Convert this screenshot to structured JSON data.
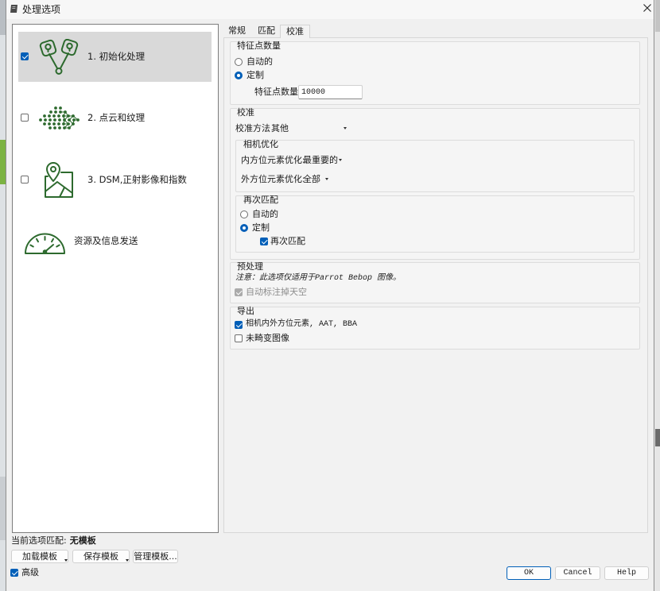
{
  "window": {
    "title": "处理选项",
    "app_icon": "app-icon",
    "close_icon": "close-icon"
  },
  "steps": [
    {
      "label": "1. 初始化处理",
      "checked": true,
      "selected": true,
      "icon": "initial-processing-icon"
    },
    {
      "label": "2. 点云和纹理",
      "checked": false,
      "selected": false,
      "icon": "point-cloud-icon"
    },
    {
      "label": "3. DSM,正射影像和指数",
      "checked": false,
      "selected": false,
      "icon": "dsm-map-pin-icon"
    },
    {
      "label": "资源及信息发送",
      "selected": false,
      "icon": "gauge-icon"
    }
  ],
  "tabs": [
    {
      "label": "常规",
      "active": false
    },
    {
      "label": "匹配",
      "active": false
    },
    {
      "label": "校准",
      "active": true
    }
  ],
  "keypoints": {
    "title": "特征点数量",
    "auto_label": "自动的",
    "auto_selected": false,
    "custom_label": "定制",
    "custom_selected": true,
    "count_label": "特征点数量:",
    "count_value": "10000"
  },
  "calibration": {
    "title": "校准",
    "method_label": "校准方法",
    "method_value": "其他",
    "camera_optimization": {
      "title": "相机优化",
      "internal_label": "内方位元素优化:",
      "internal_value": "最重要的",
      "external_label": "外方位元素优化:",
      "external_value": "全部"
    },
    "rematch": {
      "title": "再次匹配",
      "auto_label": "自动的",
      "auto_selected": false,
      "custom_label": "定制",
      "custom_selected": true,
      "rematch_label": "再次匹配",
      "rematch_checked": true
    }
  },
  "preprocessing": {
    "title": "预处理",
    "note": "注意：此选项仅适用于Parrot Bebop 图像。",
    "sky_label": "自动标注掉天空",
    "sky_checked": true,
    "sky_enabled": false
  },
  "export": {
    "title": "导出",
    "camera_params_label": "相机内外方位元素, AAT, BBA",
    "camera_params_checked": true,
    "undistorted_label": "未畸变图像",
    "undistorted_checked": false
  },
  "templates": {
    "current_label": "当前选项匹配:",
    "current_value": "无模板",
    "load_label": "加载模板",
    "save_label": "保存模板",
    "manage_label": "管理模板..."
  },
  "advanced": {
    "label": "高级",
    "checked": true
  },
  "buttons": {
    "ok_label": "OK",
    "cancel_label": "Cancel",
    "help_label": "Help"
  },
  "colors": {
    "accent": "#005fb8",
    "icon_green": "#2d6a2e",
    "selected_row": "#d9d9d9"
  }
}
